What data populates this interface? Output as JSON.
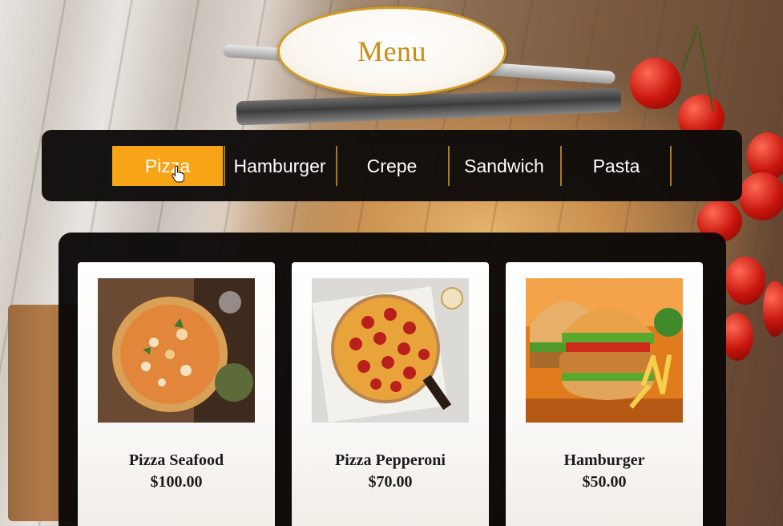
{
  "header": {
    "title": "Menu"
  },
  "tabs": [
    {
      "label": "Pizza",
      "active": true
    },
    {
      "label": "Hamburger",
      "active": false
    },
    {
      "label": "Crepe",
      "active": false
    },
    {
      "label": "Sandwich",
      "active": false
    },
    {
      "label": "Pasta",
      "active": false
    }
  ],
  "products": [
    {
      "name": "Pizza Seafood",
      "price": "$100.00",
      "image_icon": "seafood-pizza-image"
    },
    {
      "name": "Pizza Pepperoni",
      "price": "$70.00",
      "image_icon": "pepperoni-pizza-image"
    },
    {
      "name": "Hamburger",
      "price": "$50.00",
      "image_icon": "hamburger-image"
    }
  ],
  "colors": {
    "accent": "#f7a417",
    "title": "#c98d1a",
    "bar": "#0c0a09",
    "oval_border": "#d49a22"
  }
}
